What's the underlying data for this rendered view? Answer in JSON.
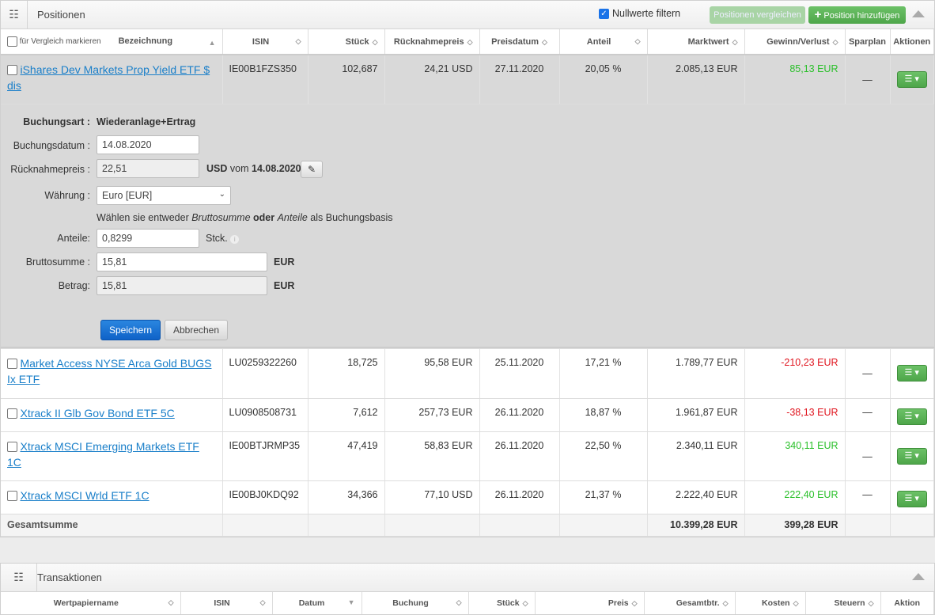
{
  "positions": {
    "title": "Positionen",
    "filter_label": "Nullwerte filtern",
    "filter_checked": true,
    "compare_button": "Positionen vergleichen",
    "add_button": "Position hinzufügen",
    "columns": {
      "mark": "für Vergleich markieren",
      "name": "Bezeichnung",
      "isin": "ISIN",
      "qty": "Stück",
      "price": "Rücknahmepreis",
      "date": "Preisdatum",
      "share": "Anteil",
      "value": "Marktwert",
      "gain": "Gewinn/Verlust",
      "plan": "Sparplan",
      "actions": "Aktionen"
    },
    "rows": [
      {
        "name": "iShares Dev Markets Prop Yield ETF $ dis",
        "isin": "IE00B1FZS350",
        "qty": "102,687",
        "price": "24,21 USD",
        "date": "27.11.2020",
        "share": "20,05 %",
        "value": "2.085,13 EUR",
        "gain": "85,13 EUR",
        "plan": "—"
      },
      {
        "name": "Market Access NYSE Arca Gold BUGS Ix ETF",
        "isin": "LU0259322260",
        "qty": "18,725",
        "price": "95,58 EUR",
        "date": "25.11.2020",
        "share": "17,21 %",
        "value": "1.789,77 EUR",
        "gain": "-210,23 EUR",
        "plan": "—"
      },
      {
        "name": "Xtrack II Glb Gov Bond ETF 5C",
        "isin": "LU0908508731",
        "qty": "7,612",
        "price": "257,73 EUR",
        "date": "26.11.2020",
        "share": "18,87 %",
        "value": "1.961,87 EUR",
        "gain": "-38,13 EUR",
        "plan": "—"
      },
      {
        "name": "Xtrack MSCI Emerging Markets ETF 1C",
        "isin": "IE00BTJRMP35",
        "qty": "47,419",
        "price": "58,83 EUR",
        "date": "26.11.2020",
        "share": "22,50 %",
        "value": "2.340,11 EUR",
        "gain": "340,11 EUR",
        "plan": "—"
      },
      {
        "name": "Xtrack MSCI Wrld ETF 1C",
        "isin": "IE00BJ0KDQ92",
        "qty": "34,366",
        "price": "77,10 USD",
        "date": "26.11.2020",
        "share": "21,37 %",
        "value": "2.222,40 EUR",
        "gain": "222,40 EUR",
        "plan": "—"
      }
    ],
    "total": {
      "label": "Gesamtsumme",
      "value": "10.399,28 EUR",
      "gain": "399,28 EUR"
    }
  },
  "form": {
    "type_label": "Buchungsart :",
    "type_value": "Wiederanlage+Ertrag",
    "date_label": "Buchungsdatum :",
    "date_value": "14.08.2020",
    "price_label": "Rücknahmepreis :",
    "price_value": "22,51",
    "price_cur": "USD",
    "price_from": "vom",
    "price_date": "14.08.2020",
    "currency_label": "Währung :",
    "currency_value": "Euro [EUR]",
    "hint_1": "Wählen sie entweder ",
    "hint_2": "Bruttosumme",
    "hint_3": " oder ",
    "hint_4": "Anteile",
    "hint_5": " als Buchungsbasis",
    "shares_label": "Anteile:",
    "shares_value": "0,8299",
    "shares_unit": "Stck.",
    "gross_label": "Bruttosumme :",
    "gross_value": "15,81",
    "gross_unit": "EUR",
    "amount_label": "Betrag:",
    "amount_value": "15,81",
    "amount_unit": "EUR",
    "save": "Speichern",
    "cancel": "Abbrechen"
  },
  "transactions": {
    "title": "Transaktionen",
    "columns": [
      "Wertpapiername",
      "ISIN",
      "Datum",
      "Buchung",
      "Stück",
      "Preis",
      "Gesamtbtr.",
      "Kosten",
      "Steuern",
      "Aktion"
    ]
  },
  "colors": {
    "positive": "#2bc02b",
    "negative": "#e0141e",
    "link": "#1a7fc9",
    "primary": "#0f6fd1"
  }
}
